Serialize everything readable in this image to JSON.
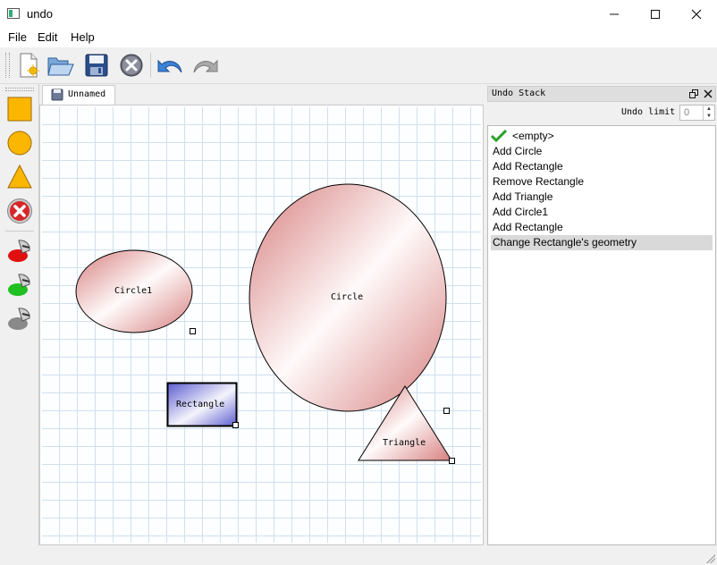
{
  "window": {
    "title": "undo"
  },
  "menu": {
    "file": "File",
    "edit": "Edit",
    "help": "Help"
  },
  "toolbar": {
    "buttons": [
      "new-document-icon",
      "open-folder-icon",
      "save-floppy-icon",
      "close-document-icon",
      "undo-arrow-icon",
      "redo-arrow-icon"
    ]
  },
  "shape_toolbar": {
    "buttons": [
      "rectangle-tool-icon",
      "circle-tool-icon",
      "triangle-tool-icon",
      "remove-shape-icon",
      "red-color-icon",
      "green-color-icon",
      "gray-color-icon"
    ]
  },
  "document": {
    "tab_label": "Unnamed"
  },
  "shapes": {
    "circle1": "Circle1",
    "circle": "Circle",
    "rectangle": "Rectangle",
    "triangle": "Triangle"
  },
  "undo_panel": {
    "title": "Undo Stack",
    "limit_label": "Undo limit",
    "limit_value": "0",
    "items": [
      "<empty>",
      "Add Circle",
      "Add Rectangle",
      "Remove Rectangle",
      "Add Triangle",
      "Add Circle1",
      "Add Rectangle",
      "Change Rectangle's geometry"
    ],
    "selected_index": 7
  },
  "colors": {
    "shape_red": "#e08b8b",
    "shape_blue": "#7c7cd8",
    "selection": "#d9d9d9",
    "grid": "#cfe0ef"
  }
}
